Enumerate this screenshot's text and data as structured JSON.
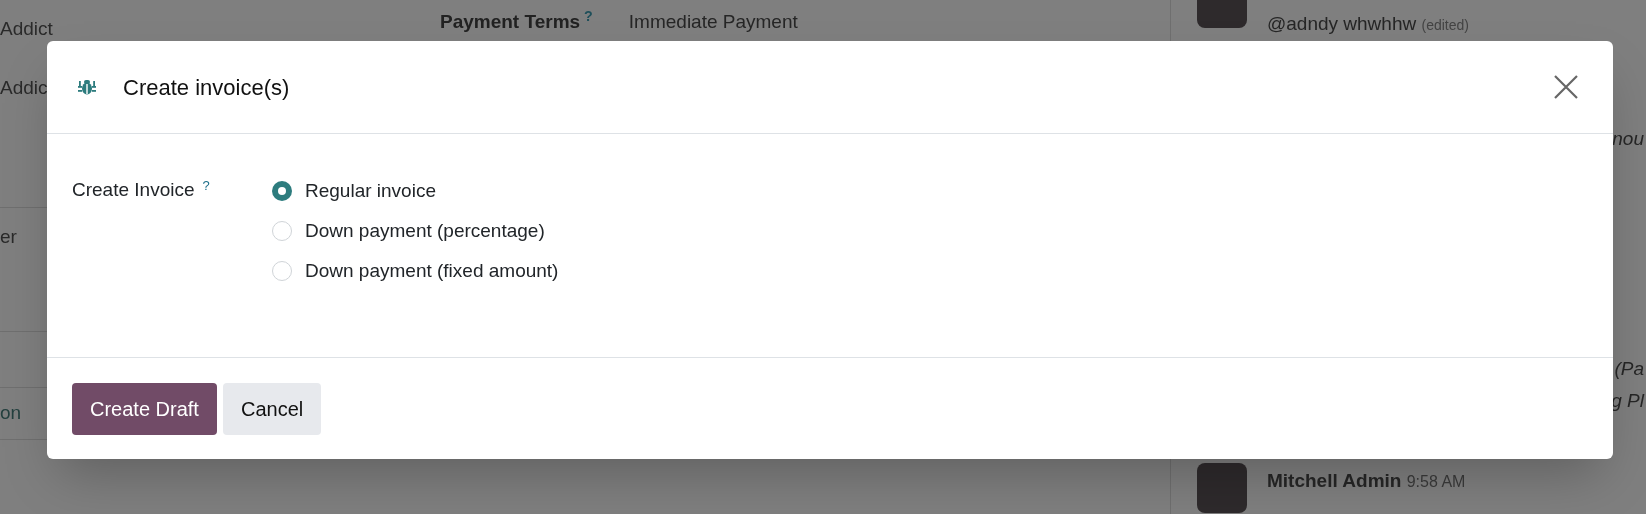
{
  "background": {
    "left_column": [
      "Addict",
      "Addic",
      "er",
      "on"
    ],
    "form": {
      "label": "Payment Terms",
      "help": "?",
      "value": "Immediate Payment"
    },
    "chatter": {
      "messages": [
        {
          "author": "@adndy whwhhw",
          "note": "(edited)"
        },
        {
          "author": "Mitchell Admin",
          "note": "9:58 AM"
        }
      ],
      "fragments": [
        "nou",
        "(Pa",
        "g Pl"
      ]
    }
  },
  "dialog": {
    "title": "Create invoice(s)",
    "field": {
      "label": "Create Invoice",
      "help": "?"
    },
    "options": [
      {
        "label": "Regular invoice",
        "selected": true
      },
      {
        "label": "Down payment (percentage)",
        "selected": false
      },
      {
        "label": "Down payment (fixed amount)",
        "selected": false
      }
    ],
    "buttons": [
      {
        "label": "Create Draft",
        "kind": "primary"
      },
      {
        "label": "Cancel",
        "kind": "secondary"
      }
    ]
  }
}
